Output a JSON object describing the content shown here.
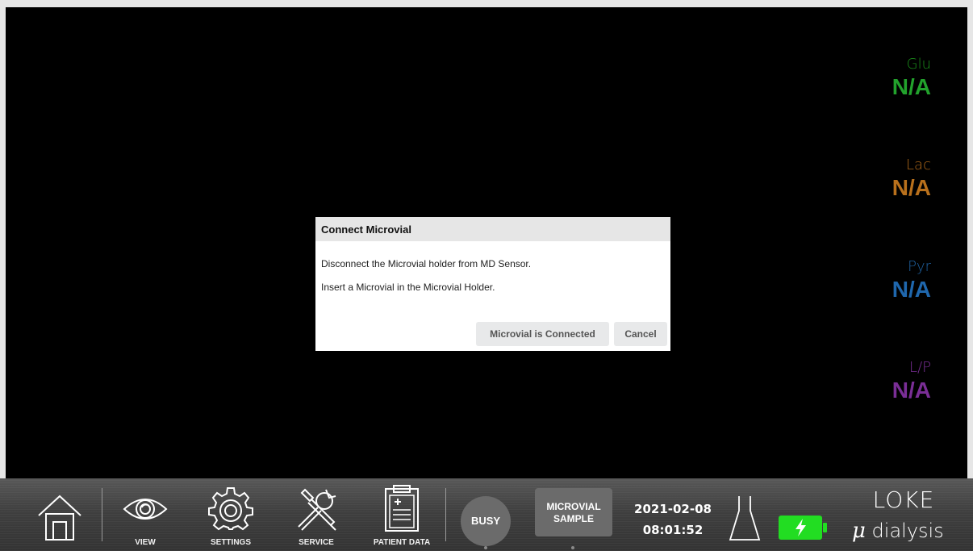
{
  "metrics": [
    {
      "name": "Glu",
      "value": "N/A",
      "name_color": "#1a8c1a",
      "value_color": "#22a22c"
    },
    {
      "name": "Lac",
      "value": "N/A",
      "name_color": "#a86418",
      "value_color": "#b8701c"
    },
    {
      "name": "Pyr",
      "value": "N/A",
      "name_color": "#1f63a4",
      "value_color": "#1f67ad"
    },
    {
      "name": "L/P",
      "value": "N/A",
      "name_color": "#7a2e96",
      "value_color": "#7a2e96"
    }
  ],
  "dialog": {
    "title": "Connect Microvial",
    "line1": "Disconnect the Microvial holder from MD Sensor.",
    "line2": "Insert a Microvial in the Microvial Holder.",
    "confirm_label": "Microvial is Connected",
    "cancel_label": "Cancel"
  },
  "bottom_bar": {
    "nav": [
      {
        "label": "",
        "icon": "home-icon"
      },
      {
        "label": "VIEW",
        "icon": "eye-icon"
      },
      {
        "label": "SETTINGS",
        "icon": "gear-icon"
      },
      {
        "label": "SERVICE",
        "icon": "tools-icon"
      },
      {
        "label": "PATIENT DATA",
        "icon": "clipboard-icon"
      }
    ],
    "busy_label": "BUSY",
    "sample_label_1": "MICROVIAL",
    "sample_label_2": "SAMPLE",
    "date": "2021-02-08",
    "time": "08:01:52",
    "flask_icon": "flask-icon",
    "battery_icon": "battery-charging-icon",
    "battery_color": "#22dd22",
    "logo_line1": "LOKE",
    "logo_mu": "μ",
    "logo_line2": "dialysis"
  }
}
